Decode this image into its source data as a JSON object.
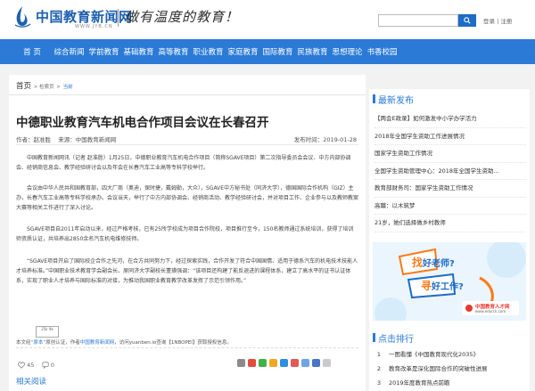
{
  "header": {
    "logo_text": "中国教育新闻网",
    "logo_url": "WWW.JYB.CN",
    "slogan": "做有温度的教育！",
    "search_button": "search-icon",
    "login_label": "登录",
    "separator": "|",
    "register_label": "注册"
  },
  "nav": {
    "items": [
      "首 页",
      "综合新闻",
      "学前教育",
      "基础教育",
      "高等教育",
      "职业教育",
      "家庭教育",
      "国际教育",
      "民族教育",
      "思想理论",
      "书香校园"
    ]
  },
  "breadcrumb": {
    "home": "首页",
    "section": "> 检索页",
    "sep": ">",
    "current": "当前"
  },
  "article": {
    "title": "中德职业教育汽车机电合作项目会议在长春召开",
    "author_label": "作者：赵准胜",
    "source_label": "来源：中国教育新闻网",
    "date_label": "发布时间：2019-01-28",
    "paragraphs": [
      "中国教育新闻网讯（记者 赵准胜）1月25日，中德职业教育汽车机电合作项目（简称SGAVE项目）第二次指导委员会会议、中方内部协调会、经销商信息会、教学经验研讨会以及年会在长春汽车工业高等专科学校举行。",
      "会议由中华人民共和国教育部，四大厂商（奥迪，保时捷，戴姆勒，大众），SGAVE中方秘书处（同济大学），德国国际合作机构（GIZ）主办，长春汽车工业高等专科学校承办。会议当天，举行了中方内部协调会、经销商活动、教学经验研讨会，并对项目工作、企业参与以及教师教案大赛等相关工作进行了深入讨论。",
      "SGAVE项目自2011年启动以来，经过严格考核，已有25所学校成为项目合作院校，项目推行至今，150名教师通过系统培训，获得了培训师资质认证，共培养出2850余名汽车机电维修技师。",
      "“SGAVE项目开启了国际校企合作之先河，在合方共同努力下，经过探索实践，合作开发了符合中国国情、适用于德系汽车的机电技术技能人才培养标准。”中国职业技术教育学会副会长、原同济大学副校长董璜强调：“该项目还构建了能反退进的课程体系，建立了高水平的证书认证体系，实现了职业人才培养与国际标准的对接，为推动我国职业教育教学改革发挥了示范引领作用。”"
    ],
    "stamp_text": "25k 9k",
    "source_prefix": "本文经",
    "source_name": "“原本”",
    "source_mid": "原创认证，作者",
    "source_author": "中国教育新闻网",
    "source_tail": "，访问yuanben.io查询【1NBOPEI】获取授权信息。",
    "likes": "45",
    "comments": "0",
    "read_more": "相关阅读"
  },
  "sidebar": {
    "latest_title": "最新发布",
    "latest_items": [
      "【两会E政录】如何激发中小学办学活力",
      "2018年全国学生资助工作进展情况",
      "国家学生资助工作情况",
      "全国学生资助管理中心：2018年全国学生资助...",
      "教育部财务司：国家学生资助工作情况",
      "高職：以木筑梦",
      "21岁，她们选择做乡村教师"
    ],
    "ad": {
      "line1": "找",
      "line2": "好老师?",
      "line3": "寻",
      "line4": "好工作?",
      "brand": "中国教育人才网",
      "brand_url": "www.edurck.com"
    },
    "rank_title": "点击排行",
    "rank_items": [
      {
        "num": "1",
        "text": "一图看懂《中国教育现代化2035》"
      },
      {
        "num": "2",
        "text": "教育改革是深化国际合作的突破性进展"
      },
      {
        "num": "3",
        "text": "2019年度教育热点前瞻"
      }
    ]
  },
  "colors": {
    "brand_blue": "#2a7ad6",
    "title": "#222222"
  }
}
